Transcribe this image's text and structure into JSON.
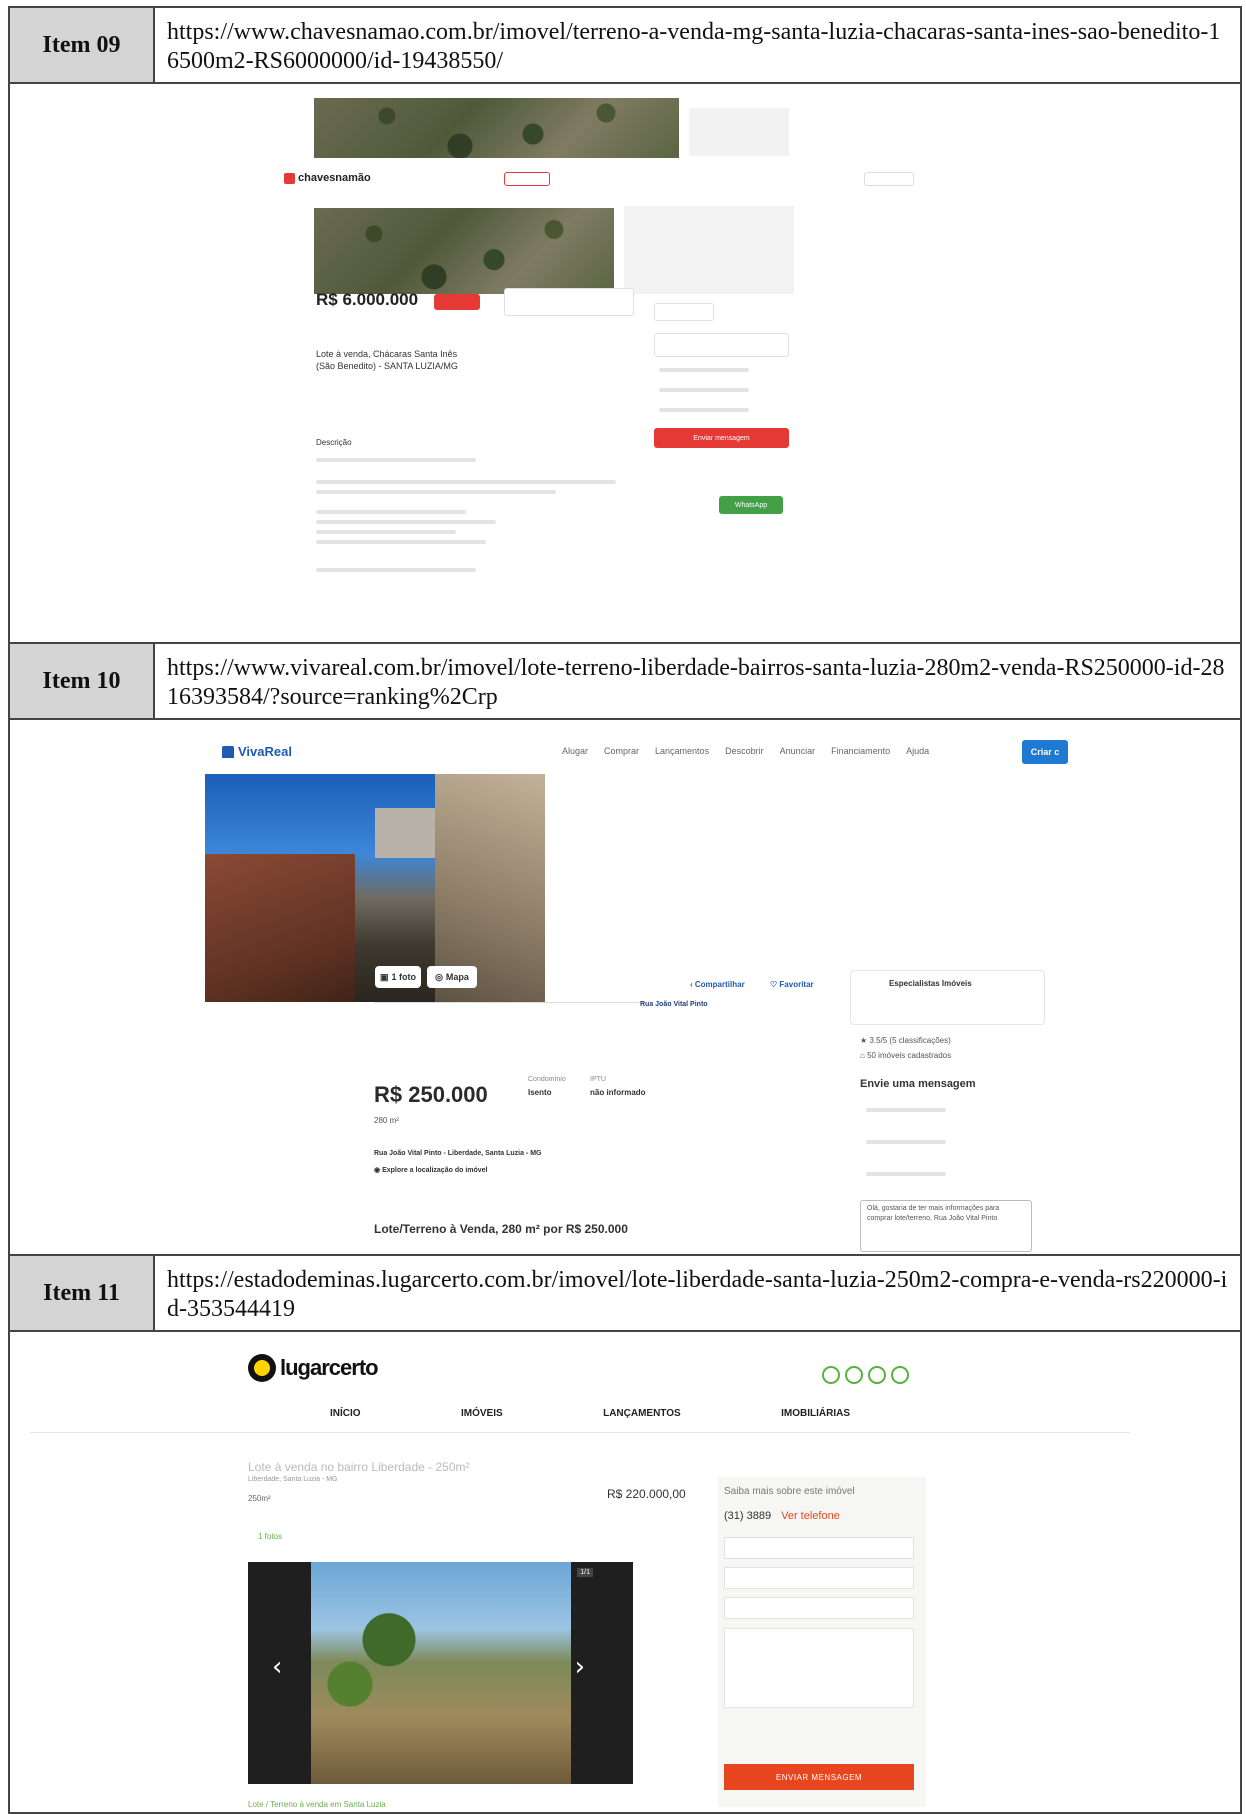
{
  "items": [
    {
      "label": "Item 09",
      "url": "https://www.chavesnamao.com.br/imovel/terreno-a-venda-mg-santa-luzia-chacaras-santa-ines-sao-benedito-16500m2-RS6000000/id-19438550/"
    },
    {
      "label": "Item 10",
      "url": "https://www.vivareal.com.br/imovel/lote-terreno-liberdade-bairros-santa-luzia-280m2-venda-RS250000-id-2816393584/?source=ranking%2Crp"
    },
    {
      "label": "Item 11",
      "url": "https://estadodeminas.lugarcerto.com.br/imovel/lote-liberdade-santa-luzia-250m2-compra-e-venda-rs220000-id-353544419"
    }
  ],
  "shot09": {
    "logo": "chavesnamão",
    "price": "R$ 6.000.000",
    "title": "Lote à venda, Chácaras Santa Inês (São Benedito) - SANTA LUZIA/MG",
    "description_label": "Descrição",
    "send_button": "Enviar mensagem",
    "whatsapp": "WhatsApp"
  },
  "shot10": {
    "logo": "VivaReal",
    "nav": [
      "Alugar",
      "Comprar",
      "Lançamentos",
      "Descobrir",
      "Anunciar",
      "Financiamento",
      "Ajuda"
    ],
    "cta": "Criar c",
    "photo_btn": "1 foto",
    "map_btn": "Mapa",
    "share": "Compartilhar",
    "favorite": "Favoritar",
    "breadcrumb_current": "Rua João Vital Pinto",
    "price": "R$ 250.000",
    "condo_label": "Condomínio",
    "condo_value": "Isento",
    "iptu_label": "IPTU",
    "iptu_value": "não informado",
    "area": "280 m²",
    "address": "Rua João Vital Pinto - Liberdade, Santa Luzia - MG",
    "explore": "Explore a localização do imóvel",
    "footer_title": "Lote/Terreno à Venda, 280 m² por R$ 250.000",
    "agency": "Especialistas Imóveis",
    "rating": "3.5/5 (5 classificações)",
    "count": "50 imóveis cadastrados",
    "message_heading": "Envie uma mensagem",
    "message_text": "Olá, gostaria de ter mais informações para comprar lote/terreno, Rua João Vital Pinto"
  },
  "shot11": {
    "logo": "lugarcerto",
    "nav": [
      "INÍCIO",
      "IMÓVEIS",
      "LANÇAMENTOS",
      "IMOBILIÁRIAS"
    ],
    "title": "Lote à venda no bairro Liberdade - 250m²",
    "location": "Liberdade, Santa Luzia - MG",
    "area": "250m²",
    "price": "R$ 220.000,00",
    "photos": "1 fotos",
    "counter": "1/1",
    "side_heading": "Saiba mais sobre este imóvel",
    "phone": "(31) 3889",
    "phone_link": "Ver telefone",
    "send_button": "ENVIAR MENSAGEM",
    "footer": "Lote / Terreno à venda em Santa Luzia"
  }
}
